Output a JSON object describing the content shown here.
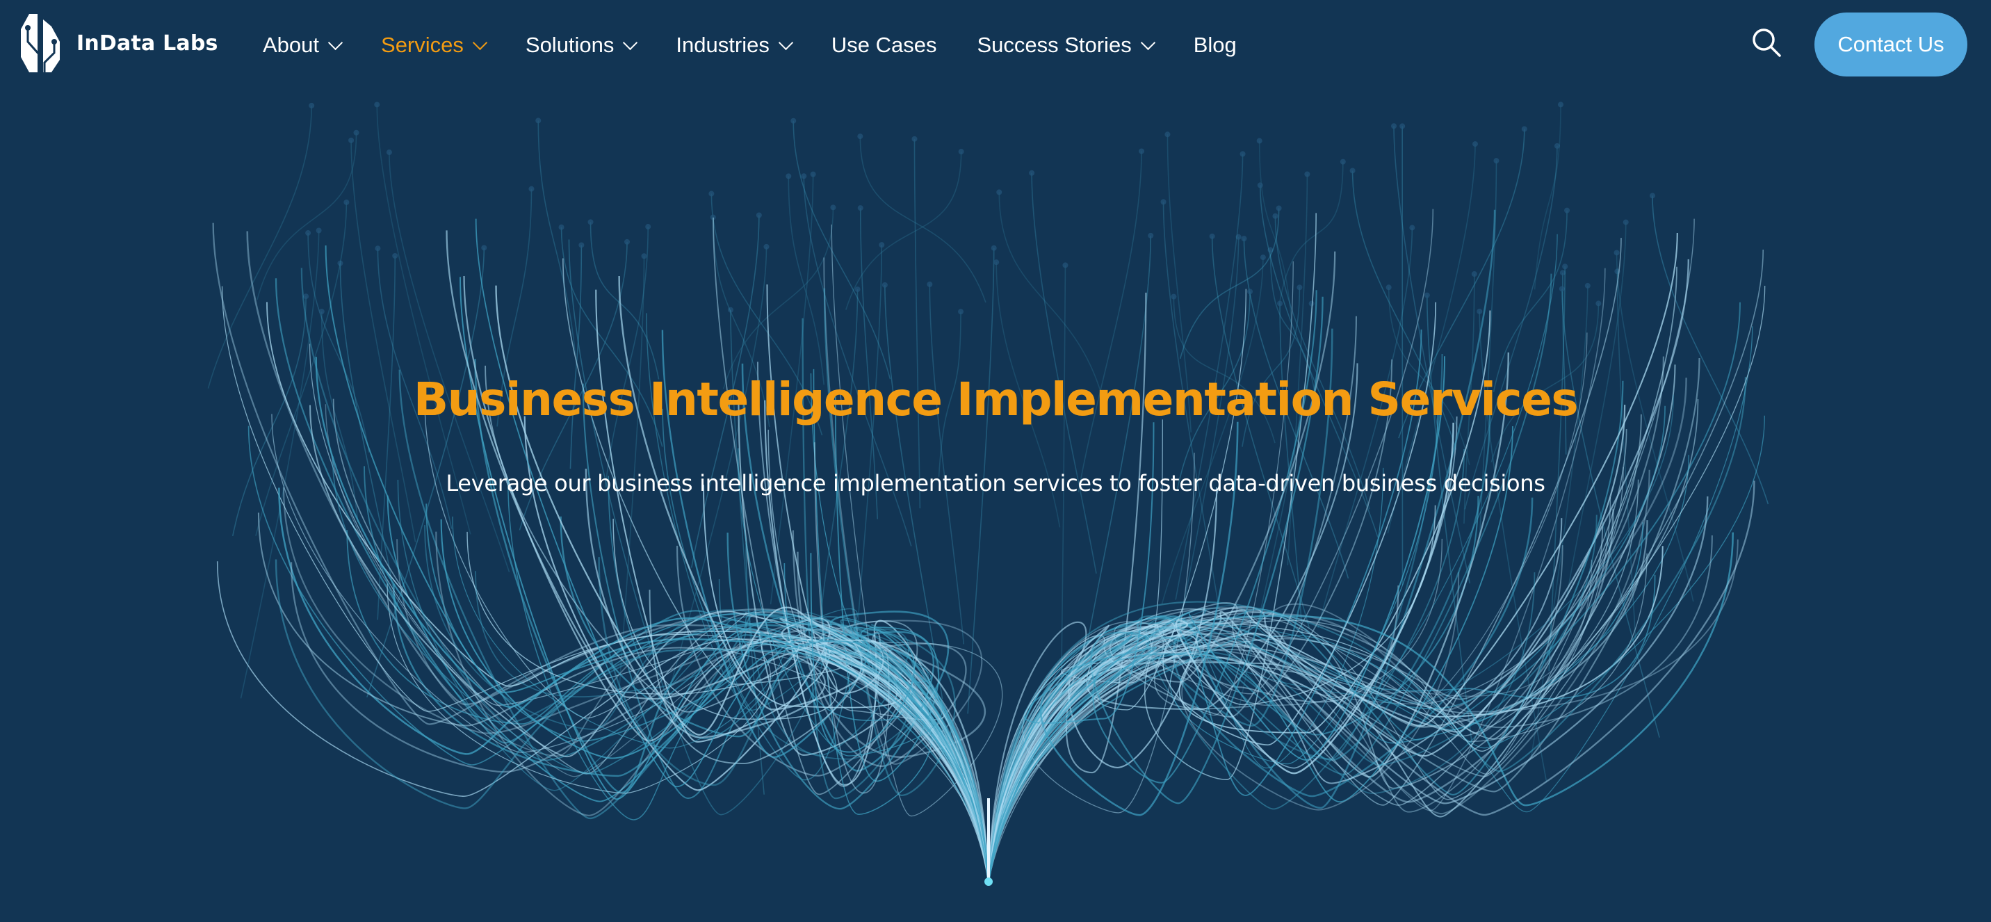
{
  "brand": {
    "name": "InData Labs"
  },
  "nav": {
    "items": [
      {
        "label": "About",
        "has_dropdown": true,
        "active": false
      },
      {
        "label": "Services",
        "has_dropdown": true,
        "active": true
      },
      {
        "label": "Solutions",
        "has_dropdown": true,
        "active": false
      },
      {
        "label": "Industries",
        "has_dropdown": true,
        "active": false
      },
      {
        "label": "Use Cases",
        "has_dropdown": false,
        "active": false
      },
      {
        "label": "Success Stories",
        "has_dropdown": true,
        "active": false
      },
      {
        "label": "Blog",
        "has_dropdown": false,
        "active": false
      }
    ],
    "search_icon": "search-icon",
    "contact_label": "Contact Us"
  },
  "hero": {
    "title": "Business Intelligence Implementation Services",
    "subtitle": "Leverage our business intelligence implementation services to foster data-driven business decisions",
    "background_graphic": "data-fountain-curves"
  },
  "colors": {
    "background": "#123554",
    "accent": "#F39C12",
    "button": "#52A8DF",
    "text": "#FFFFFF",
    "curve_light": "#A8D8F0",
    "curve_teal": "#3FA3C4"
  }
}
